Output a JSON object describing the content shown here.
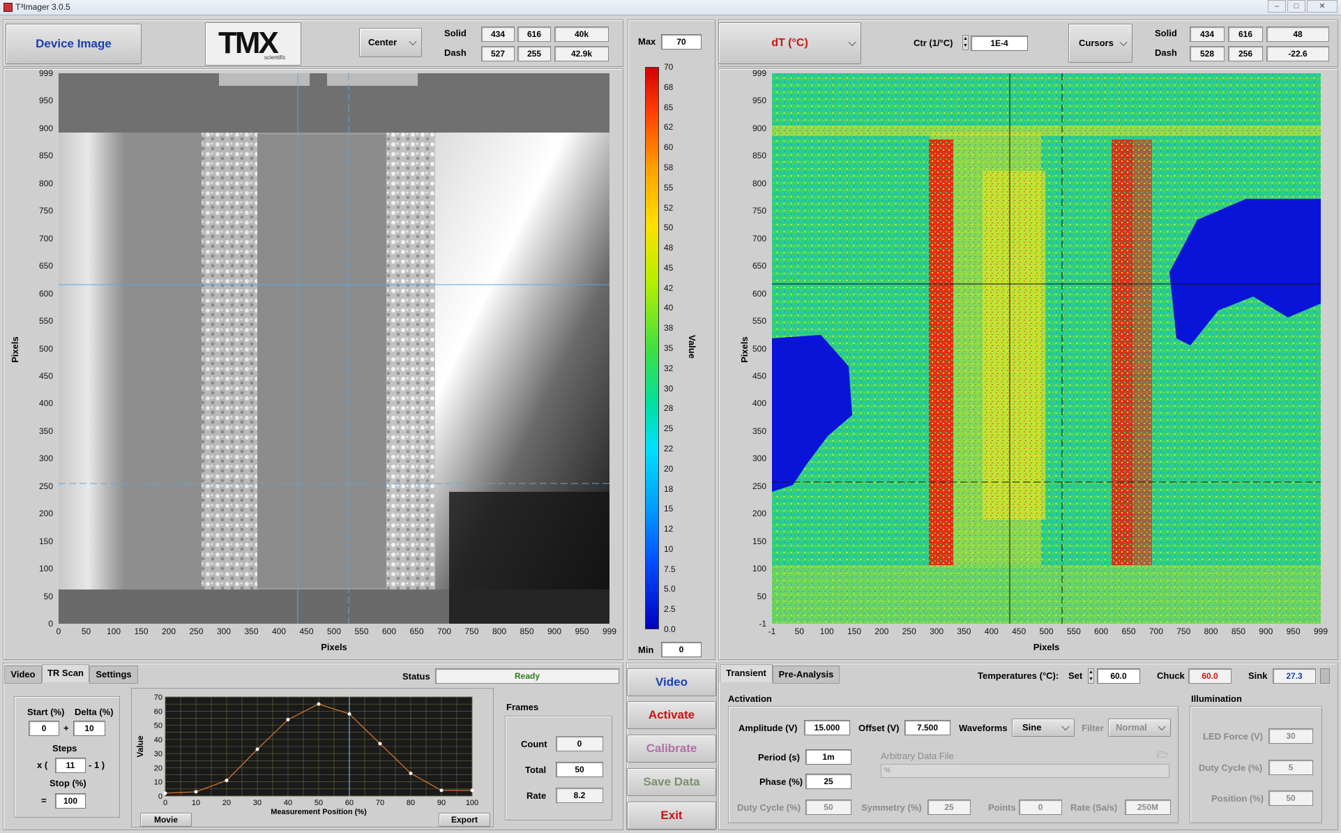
{
  "window": {
    "title": "T³Imager 3.0.5"
  },
  "left": {
    "device_image_label": "Device Image",
    "logo_text": "TMX",
    "logo_sub": "scientific",
    "center_label": "Center",
    "solid": {
      "label": "Solid",
      "x": "434",
      "y": "616",
      "v": "40k"
    },
    "dash": {
      "label": "Dash",
      "x": "527",
      "y": "255",
      "v": "42.9k"
    },
    "xlabel": "Pixels",
    "ylabel": "Pixels",
    "xticks": [
      "0",
      "50",
      "100",
      "150",
      "200",
      "250",
      "300",
      "350",
      "400",
      "450",
      "500",
      "550",
      "600",
      "650",
      "700",
      "750",
      "800",
      "850",
      "900",
      "950",
      "999"
    ],
    "yticks": [
      "999",
      "950",
      "900",
      "850",
      "800",
      "750",
      "700",
      "650",
      "600",
      "550",
      "500",
      "450",
      "400",
      "350",
      "300",
      "250",
      "200",
      "150",
      "100",
      "50",
      "0"
    ]
  },
  "colorbar": {
    "max_label": "Max",
    "max_value": "70",
    "min_label": "Min",
    "min_value": "0",
    "value_label": "Value",
    "ticks": [
      "70",
      "68",
      "65",
      "62",
      "60",
      "58",
      "55",
      "52",
      "50",
      "48",
      "45",
      "42",
      "40",
      "38",
      "35",
      "32",
      "30",
      "28",
      "25",
      "22",
      "20",
      "18",
      "15",
      "12",
      "10",
      "7.5",
      "5.0",
      "2.5",
      "0.0"
    ]
  },
  "right": {
    "mode_label": "dT (°C)",
    "ctr_label": "Ctr (1/°C)",
    "ctr_value": "1E-4",
    "cursors_label": "Cursors",
    "solid": {
      "label": "Solid",
      "x": "434",
      "y": "616",
      "v": "48"
    },
    "dash": {
      "label": "Dash",
      "x": "528",
      "y": "256",
      "v": "-22.6"
    },
    "xlabel": "Pixels",
    "ylabel": "Pixels",
    "xticks": [
      "-1",
      "50",
      "100",
      "150",
      "200",
      "250",
      "300",
      "350",
      "400",
      "450",
      "500",
      "550",
      "600",
      "650",
      "700",
      "750",
      "800",
      "850",
      "900",
      "950",
      "999"
    ],
    "yticks": [
      "999",
      "950",
      "900",
      "850",
      "800",
      "750",
      "700",
      "650",
      "600",
      "550",
      "500",
      "450",
      "400",
      "350",
      "300",
      "250",
      "200",
      "150",
      "100",
      "50",
      "-1"
    ]
  },
  "bottom_left": {
    "tabs": [
      "Video",
      "TR Scan",
      "Settings"
    ],
    "status_label": "Status",
    "status_value": "Ready",
    "start_label": "Start (%)",
    "start_value": "0",
    "delta_label": "Delta (%)",
    "delta_value": "10",
    "plus": "+",
    "steps_label": "Steps",
    "x_open": "x (",
    "steps_value": "11",
    "minus_close": "- 1 )",
    "stop_label": "Stop (%)",
    "eq": "=",
    "stop_value": "100",
    "movie_button": "Movie",
    "export_button": "Export",
    "frames_label": "Frames",
    "count_label": "Count",
    "count_value": "0",
    "total_label": "Total",
    "total_value": "50",
    "rate_label": "Rate",
    "rate_value": "8.2"
  },
  "chart_data": {
    "type": "line",
    "xlabel": "Measurement Position (%)",
    "ylabel": "Value",
    "x": [
      0,
      10,
      20,
      30,
      40,
      50,
      60,
      70,
      80,
      90,
      100
    ],
    "series": [
      {
        "values": [
          2,
          3,
          11,
          33,
          54,
          65,
          58,
          37,
          16,
          4,
          4
        ]
      }
    ],
    "xlim": [
      0,
      100
    ],
    "ylim": [
      0,
      70
    ],
    "xticks": [
      "0",
      "10",
      "20",
      "30",
      "40",
      "50",
      "60",
      "70",
      "80",
      "90",
      "100"
    ],
    "yticks": [
      "0",
      "10",
      "20",
      "30",
      "40",
      "50",
      "60",
      "70"
    ],
    "line_color": "#e07a2a",
    "background": "#1a1a1a",
    "grid": true
  },
  "actions": {
    "video": "Video",
    "activate": "Activate",
    "calibrate": "Calibrate",
    "save_data": "Save Data",
    "exit": "Exit"
  },
  "bottom_right": {
    "tabs": [
      "Transient",
      "Pre-Analysis"
    ],
    "temps_label": "Temperatures (°C):",
    "set_label": "Set",
    "set_value": "60.0",
    "chuck_label": "Chuck",
    "chuck_value": "60.0",
    "sink_label": "Sink",
    "sink_value": "27.3",
    "activation_label": "Activation",
    "amplitude_label": "Amplitude (V)",
    "amplitude_value": "15.000",
    "offset_label": "Offset (V)",
    "offset_value": "7.500",
    "waveforms_label": "Waveforms",
    "waveform_value": "Sine",
    "filter_label": "Filter",
    "filter_value": "Normal",
    "period_label": "Period (s)",
    "period_value": "1m",
    "arb_label": "Arbitrary Data File",
    "arb_value": "%",
    "phase_label": "Phase (%)",
    "phase_value": "25",
    "duty_label": "Duty Cycle (%)",
    "duty_value": "50",
    "symmetry_label": "Symmetry (%)",
    "symmetry_value": "25",
    "points_label": "Points",
    "points_value": "0",
    "rate_label": "Rate (Sa/s)",
    "rate_value": "250M",
    "illumination_label": "Illumination",
    "led_label": "LED Force (V)",
    "led_value": "30",
    "ill_duty_label": "Duty Cycle (%)",
    "ill_duty_value": "5",
    "position_label": "Position (%)",
    "position_value": "50"
  },
  "colors": {
    "accent_blue": "#1a3fb0",
    "red": "#cc1111",
    "green_status": "#2e7d1e",
    "sink_blue": "#1a3fb0"
  }
}
